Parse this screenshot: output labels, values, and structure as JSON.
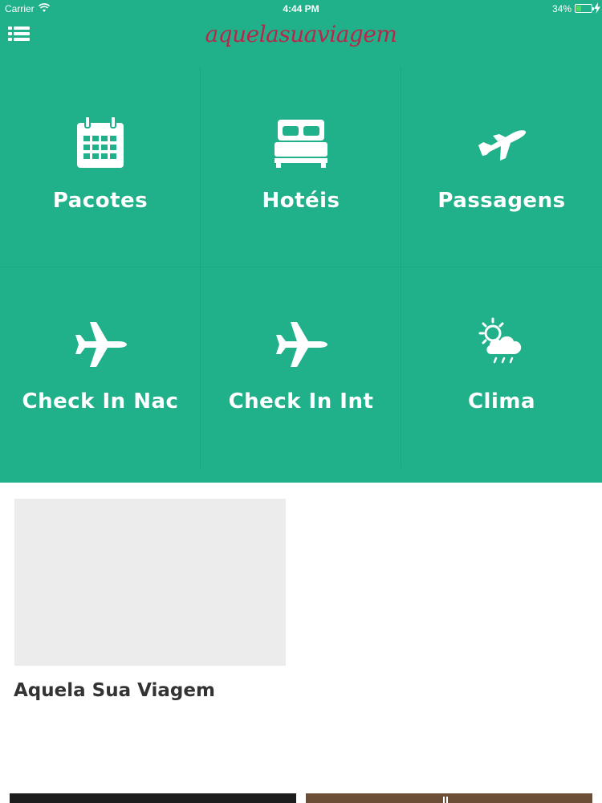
{
  "status_bar": {
    "carrier": "Carrier",
    "time": "4:44 PM",
    "battery_percent": "34%",
    "battery_level": 0.34
  },
  "nav": {
    "brand": "aquelasuaviagem",
    "brand_color": "#b8264a",
    "menu_icon": "list-menu-icon"
  },
  "theme": {
    "accent": "#21b18a"
  },
  "tiles": [
    {
      "label": "Pacotes",
      "icon": "calendar-icon"
    },
    {
      "label": "Hotéis",
      "icon": "bed-icon"
    },
    {
      "label": "Passagens",
      "icon": "airplane-takeoff-icon"
    },
    {
      "label": "Check In Nac",
      "icon": "airplane-icon"
    },
    {
      "label": "Check In Int",
      "icon": "airplane-icon"
    },
    {
      "label": "Clima",
      "icon": "weather-sun-cloud-icon"
    }
  ],
  "feed": {
    "cards": [
      {
        "title": "Aquela Sua Viagem"
      }
    ]
  }
}
